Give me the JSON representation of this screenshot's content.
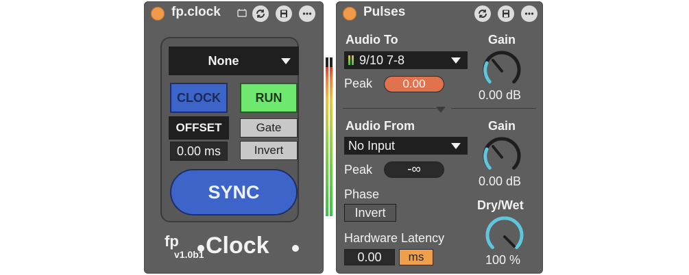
{
  "clock_device": {
    "title": "fp.clock",
    "sync_dropdown": {
      "value": "None"
    },
    "clock_button": "CLOCK",
    "run_button": "RUN",
    "offset_label": "OFFSET",
    "offset_value": "0.00 ms",
    "gate_button": "Gate",
    "invert_button": "Invert",
    "sync_button": "SYNC",
    "logo": {
      "fp": "fp",
      "version": "v1.0b1",
      "name": "Clock"
    }
  },
  "pulses_device": {
    "title": "Pulses",
    "audio_to": {
      "label": "Audio To",
      "dropdown_value": "9/10 7-8",
      "peak_label": "Peak",
      "peak_value": "0.00",
      "gain_label": "Gain",
      "gain_value": "0.00 dB"
    },
    "audio_from": {
      "label": "Audio From",
      "dropdown_value": "No Input",
      "peak_label": "Peak",
      "peak_value": "-∞",
      "gain_label": "Gain",
      "gain_value": "0.00 dB"
    },
    "phase": {
      "label": "Phase",
      "button": "Invert"
    },
    "drywet": {
      "label": "Dry/Wet",
      "value": "100 %"
    },
    "latency": {
      "label": "Hardware Latency",
      "value": "0.00",
      "unit": "ms"
    }
  },
  "colors": {
    "led": "#f09a4a",
    "clock_blue": "#3d64c8",
    "run_green": "#6ee86e",
    "peak_orange": "#e0734e",
    "unit_orange": "#f0a04a",
    "knob_arc": "#5fc6dc"
  }
}
